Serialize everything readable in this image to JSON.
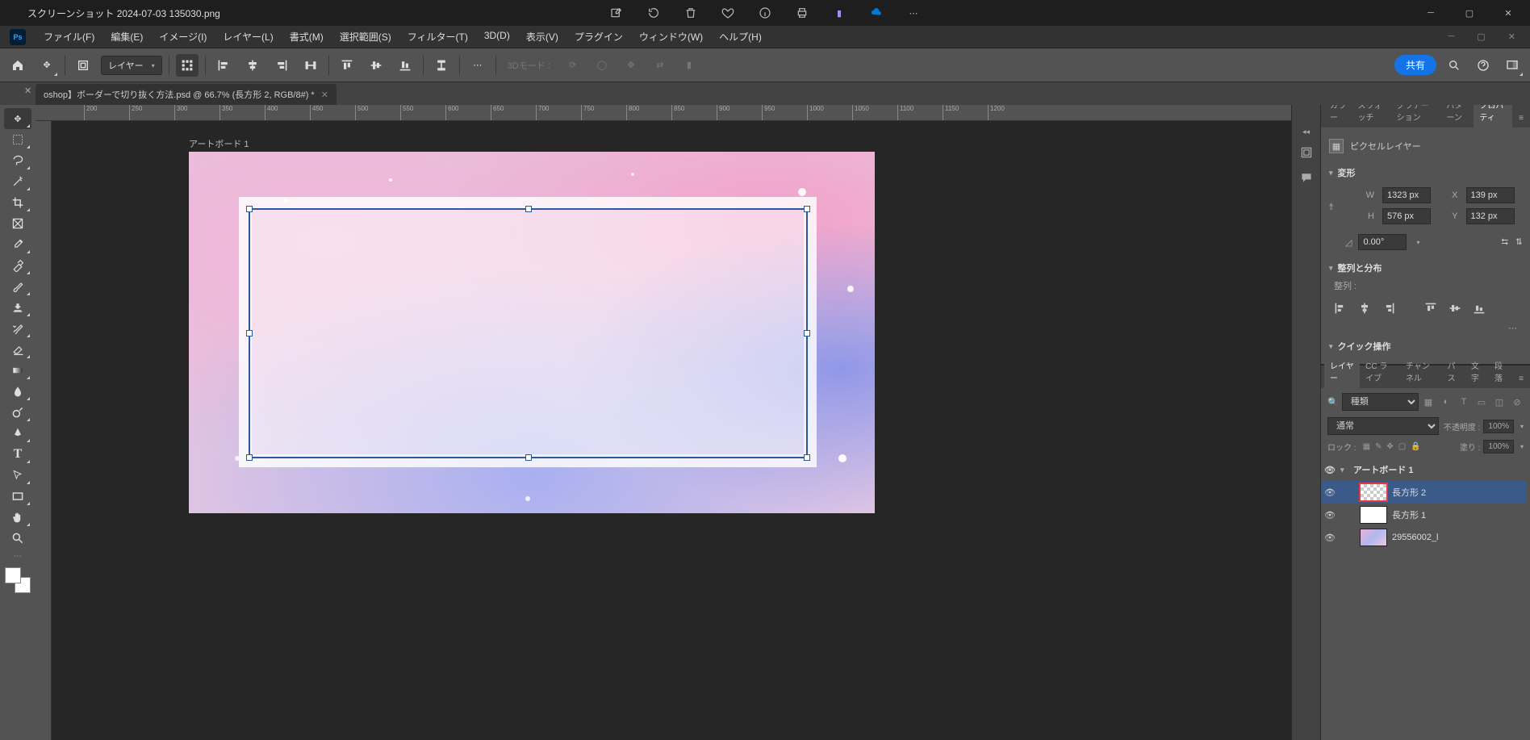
{
  "outer_window": {
    "filename": "スクリーンショット 2024-07-03 135030.png"
  },
  "ps_window": {
    "logo": "Ps"
  },
  "menubar": {
    "file": "ファイル(F)",
    "edit": "編集(E)",
    "image": "イメージ(I)",
    "layer": "レイヤー(L)",
    "type": "書式(M)",
    "select": "選択範囲(S)",
    "filter": "フィルター(T)",
    "threed": "3D(D)",
    "view": "表示(V)",
    "plugin": "プラグイン",
    "window": "ウィンドウ(W)",
    "help": "ヘルプ(H)"
  },
  "options_bar": {
    "layer_dd": "レイヤー",
    "threed_mode": "3Dモード :",
    "share": "共有"
  },
  "doc_tab": {
    "title": "oshop】ボーダーで切り抜く方法.psd @ 66.7% (長方形 2, RGB/8#) *"
  },
  "ruler_ticks": [
    "200",
    "250",
    "300",
    "350",
    "400",
    "450",
    "500",
    "550",
    "600",
    "650",
    "700",
    "750",
    "800",
    "850",
    "900",
    "950",
    "1000",
    "1050",
    "1100",
    "1150",
    "1200"
  ],
  "artboard": {
    "label": "アートボード 1"
  },
  "right_tabs_top": {
    "color": "カラー",
    "swatches": "スウォッチ",
    "gradient": "グラデーション",
    "pattern": "パターン",
    "properties": "プロパティ"
  },
  "properties": {
    "header": "ピクセルレイヤー",
    "transform_title": "変形",
    "W_label": "W",
    "W_val": "1323 px",
    "X_label": "X",
    "X_val": "139 px",
    "H_label": "H",
    "H_val": "576 px",
    "Y_label": "Y",
    "Y_val": "132 px",
    "angle_val": "0.00°",
    "align_title": "整列と分布",
    "align_label": "整列 :",
    "quick_title": "クイック操作"
  },
  "layers_tabs": {
    "layers": "レイヤー",
    "cclive": "CC ライブ",
    "channels": "チャンネル",
    "paths": "パス",
    "char": "文字",
    "para": "段落"
  },
  "layers_panel": {
    "kind_label": "種類",
    "blend_mode": "通常",
    "opacity_label": "不透明度 :",
    "opacity_val": "100%",
    "lock_label": "ロック :",
    "fill_label": "塗り :",
    "fill_val": "100%",
    "artboard_name": "アートボード 1",
    "layer2": "長方形 2",
    "layer1": "長方形 1",
    "layer_img": "29556002_l"
  }
}
